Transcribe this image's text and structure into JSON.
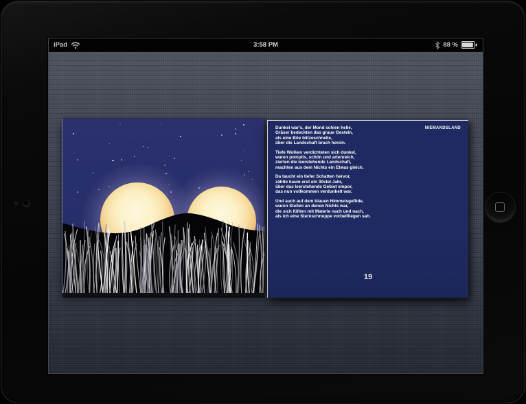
{
  "status_bar": {
    "device_label": "iPad",
    "time": "3:58 PM",
    "battery_percent": "88 %",
    "icons": [
      "wifi-icon",
      "bluetooth-icon",
      "battery-icon"
    ]
  },
  "book": {
    "right_page": {
      "title": "NIEMANDSLAND",
      "page_number": "19",
      "stanzas": [
        [
          "Dunkel war's, der Mond schien helle,",
          "Gräser bedeckten das graue Gestein,",
          "als eine Böe blitzeschnelle,",
          "über die Landschaft brach herein."
        ],
        [
          "Tiefe Wolken verdichteten sich dunkel,",
          "waren pompös, schön und artenreich,",
          "zierten die leerstehende Landschaft,",
          "machten aus dem Nichts ein Etwas gleich."
        ],
        [
          "Da taucht ein tiefer Schatten hervor,",
          "zählte kaum erst ein 30stel Jahr,",
          "über das leerstehende Gebiet empor,",
          "das nun vollkommen verdunkelt war."
        ],
        [
          "Und auch auf dem blauen Himmelsgefilde,",
          "waren Stellen an denen Nichts war,",
          "die sich füllten mit Materie nach und nach,",
          "als ich eine Sternschnuppe vorbeifliegen sah."
        ]
      ]
    }
  },
  "colors": {
    "sky": "#272f6a",
    "page_navy": "#1f2a62",
    "moon": "#f7dfa4",
    "linen_background": "#3d424e",
    "text": "#ffffff"
  }
}
